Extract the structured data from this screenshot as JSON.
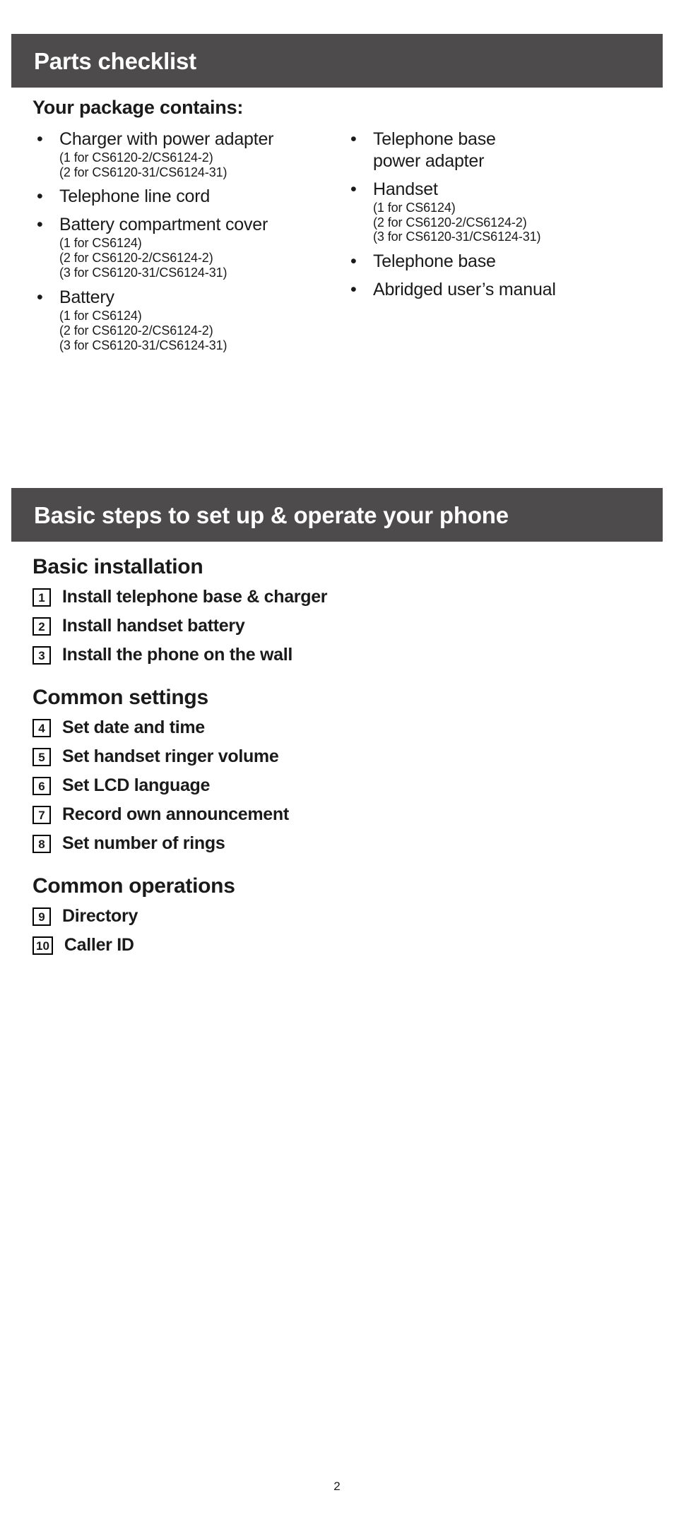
{
  "sections": [
    {
      "bar_title": "Parts checklist",
      "subhead": "Your package contains:",
      "left_column": [
        {
          "main": "Charger with power adapter",
          "subs": [
            "(1 for CS6120-2/CS6124-2)",
            "(2 for CS6120-31/CS6124-31)"
          ]
        },
        {
          "main": "Telephone line cord",
          "subs": []
        },
        {
          "main": "Battery compartment cover",
          "subs": [
            "(1 for CS6124)",
            "(2 for CS6120-2/CS6124-2)",
            "(3 for CS6120-31/CS6124-31)"
          ]
        },
        {
          "main": "Battery",
          "subs": [
            "(1 for CS6124)",
            "(2 for CS6120-2/CS6124-2)",
            "(3 for CS6120-31/CS6124-31)"
          ]
        }
      ],
      "right_column": [
        {
          "main": "Telephone base\npower adapter",
          "subs": []
        },
        {
          "main": "Handset",
          "subs": [
            "(1 for CS6124)",
            "(2 for CS6120-2/CS6124-2)",
            "(3 for CS6120-31/CS6124-31)"
          ]
        },
        {
          "main": "Telephone base",
          "subs": []
        },
        {
          "main": "Abridged user’s manual",
          "subs": []
        }
      ]
    },
    {
      "bar_title": "Basic steps to set up & operate your phone",
      "groups": [
        {
          "title": "Basic installation",
          "steps": [
            {
              "number": "1",
              "label": "Install telephone base & charger"
            },
            {
              "number": "2",
              "label": "Install handset battery"
            },
            {
              "number": "3",
              "label": "Install the phone on the wall"
            }
          ]
        },
        {
          "title": "Common settings",
          "steps": [
            {
              "number": "4",
              "label": "Set date and time"
            },
            {
              "number": "5",
              "label": "Set handset ringer volume"
            },
            {
              "number": "6",
              "label": "Set LCD language"
            },
            {
              "number": "7",
              "label": "Record own announcement"
            },
            {
              "number": "8",
              "label": "Set number of rings"
            }
          ]
        },
        {
          "title": "Common operations",
          "steps": [
            {
              "number": "9",
              "label": "Directory"
            },
            {
              "number": "10",
              "label": "Caller ID"
            }
          ]
        }
      ]
    }
  ],
  "bullet_glyph": "•",
  "page_number": "2",
  "colors": {
    "bar_background": "#4d4b4c",
    "bar_text": "#ffffff",
    "body_text": "#1a1a1a",
    "page_background": "#ffffff"
  }
}
